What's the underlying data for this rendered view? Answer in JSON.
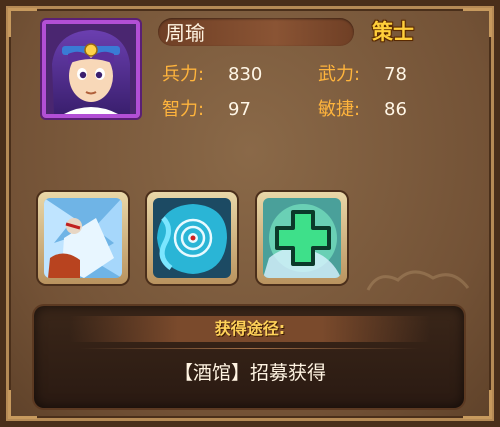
{
  "hero": {
    "name": "周瑜",
    "class": "策士",
    "portrait_icon": "hero-portrait"
  },
  "stats": [
    {
      "label": "兵力:",
      "value": "830"
    },
    {
      "label": "武力:",
      "value": "78"
    },
    {
      "label": "智力:",
      "value": "97"
    },
    {
      "label": "敏捷:",
      "value": "86"
    }
  ],
  "skills": [
    {
      "icon": "ice-warrior-skill-icon"
    },
    {
      "icon": "target-vortex-skill-icon"
    },
    {
      "icon": "heal-cross-skill-icon"
    }
  ],
  "acquisition": {
    "title": "获得途径:",
    "source": "【酒馆】招募获得"
  },
  "colors": {
    "label_orange": "#ffb43c",
    "class_gold": "#ffcf3b",
    "frame_purple": "#b24fd6"
  }
}
